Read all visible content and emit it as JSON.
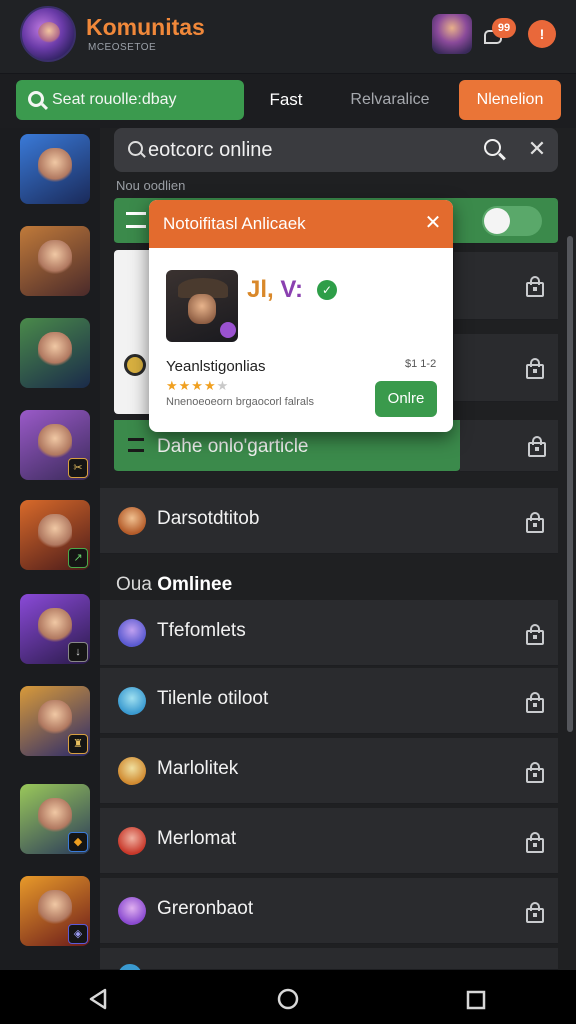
{
  "header": {
    "title": "Komunitas",
    "subtitle": "MCEOSETOE",
    "chat_count": "99",
    "alert_label": "!"
  },
  "filters": {
    "search_label": "Seat rouolle:dbay",
    "fast_label": "Fast",
    "relevance_label": "Relvaralice",
    "mention_label": "Nlenelion"
  },
  "search": {
    "value": "eotcorc online",
    "placeholder": "eotcorc online",
    "clear_symbol": "✕"
  },
  "sections": {
    "top_label": "Nou oodlien",
    "online_prefix": "Oua",
    "online_label": "Omlinee"
  },
  "rows": [
    {
      "name": "Dahe onlo'garticle",
      "avatar_color": "#2c6a3c"
    },
    {
      "name": "Darsotdtitob",
      "avatar_color": "#b45c2a"
    },
    {
      "name": "Tfefomlets",
      "avatar_color": "#5a5ad0"
    },
    {
      "name": "Tilenle otiloot",
      "avatar_color": "#3a9ad0"
    },
    {
      "name": "Marlolitek",
      "avatar_color": "#d08a30"
    },
    {
      "name": "Merlomat",
      "avatar_color": "#c8382a"
    },
    {
      "name": "Greronbaot",
      "avatar_color": "#8a4ad0"
    }
  ],
  "modal": {
    "title": "Notoifitasl Anlicaek",
    "close_symbol": "✕",
    "big_prefix": "Jl, ",
    "big_text": "V:",
    "game_name": "Yeanlstigonlias",
    "price": "$1 1-2",
    "stars": "★★★★",
    "stars_dim": "★",
    "description": "Nnenoeoeorn brgaocorl falrals",
    "button_label": "Onlre"
  },
  "rail_colors": [
    "#2a5aa8",
    "#8a4a2a",
    "#3a6a3a",
    "#6a3a8a",
    "#8a3a2a",
    "#5a2a8a",
    "#2a3a8a",
    "#4a6a3a",
    "#8a5a2a"
  ]
}
